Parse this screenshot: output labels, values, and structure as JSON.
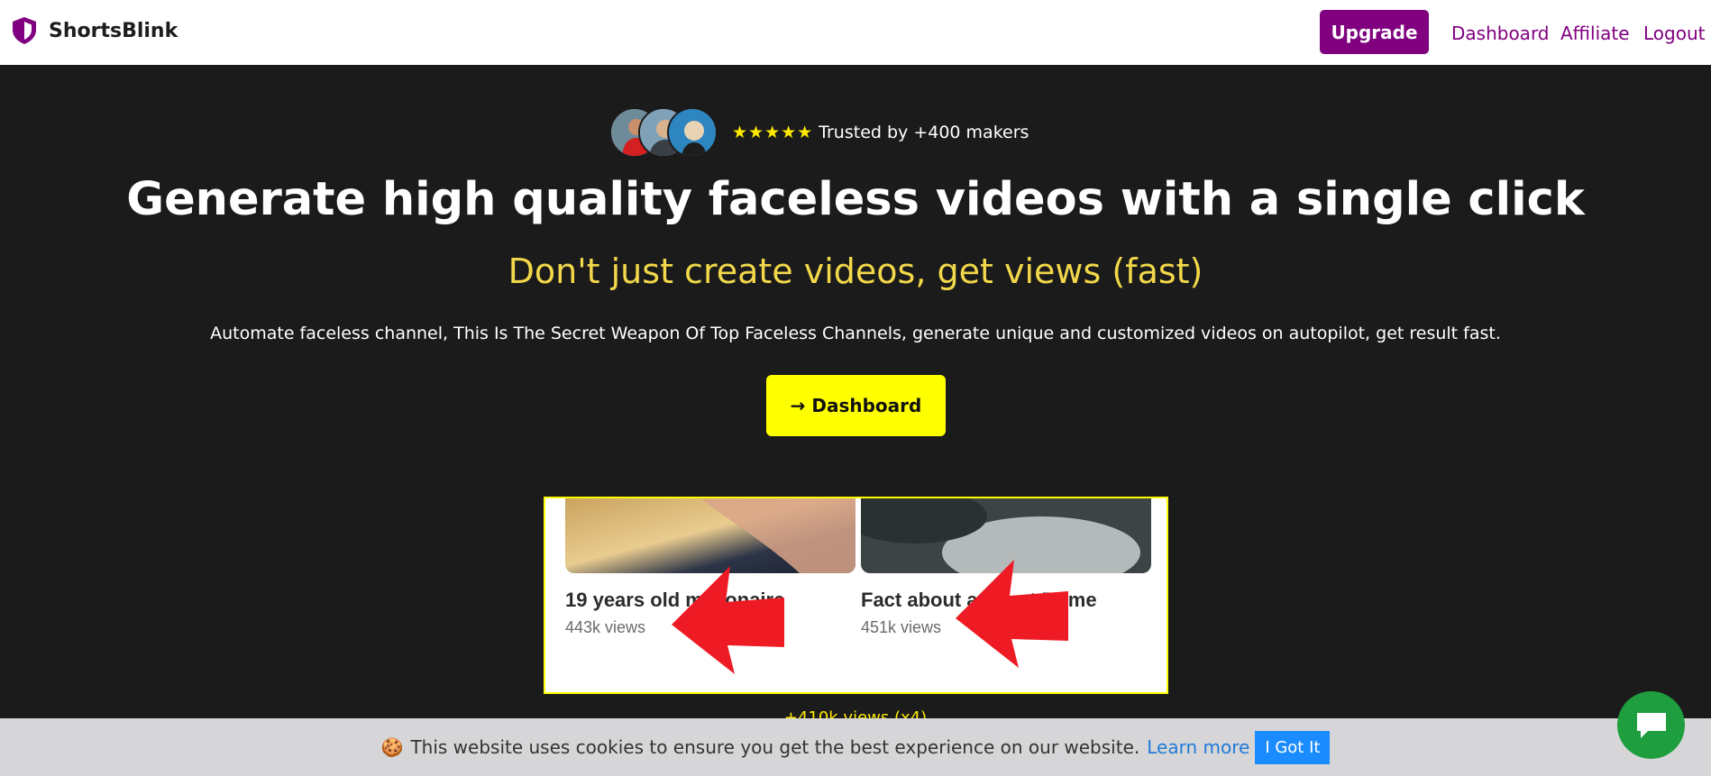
{
  "navbar": {
    "brand": "ShortsBlink",
    "upgrade_label": "Upgrade",
    "links": [
      "Dashboard",
      "Affiliate",
      "Logout"
    ]
  },
  "hero": {
    "stars": "★★★★★",
    "trust_text": "Trusted by +400 makers",
    "headline": "Generate high quality faceless videos with a single click",
    "subheadline": "Don't just create videos, get views (fast)",
    "description": "Automate faceless channel, This Is The Secret Weapon Of Top Faceless Channels, generate unique and customized videos on autopilot, get result fast.",
    "cta_label": "→ Dashboard"
  },
  "proof": {
    "cards": [
      {
        "title": "19 years old millionaire",
        "views": "443k views"
      },
      {
        "title": "Fact about ancient Rome",
        "views": "451k views"
      }
    ],
    "caption": "+410k views (x4)"
  },
  "cookie": {
    "message": "This website uses cookies to ensure you get the best experience on our website.",
    "link": "Learn more",
    "button": "I Got It"
  },
  "colors": {
    "brand_purple": "#800080",
    "cta_yellow": "#ffff00",
    "subhead_yellow": "#f2d84a",
    "hero_bg": "#1b1b1b",
    "chat_green": "#1e9e3e"
  }
}
